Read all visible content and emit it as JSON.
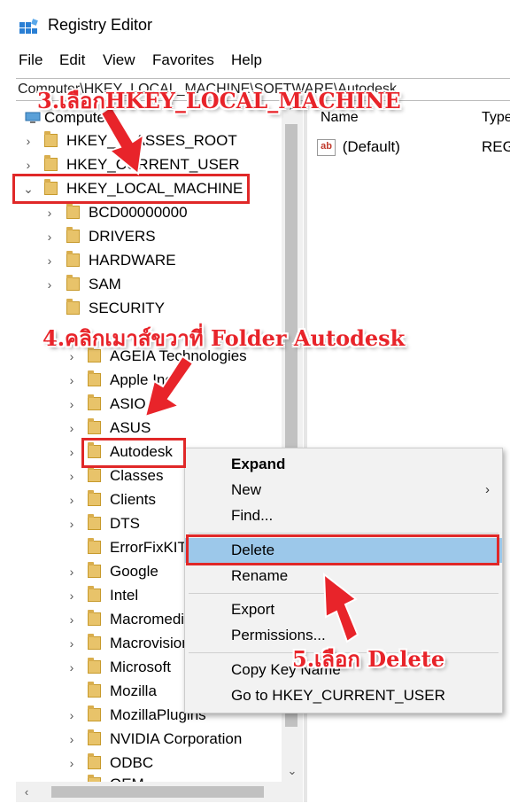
{
  "window": {
    "title": "Registry Editor"
  },
  "menu": [
    "File",
    "Edit",
    "View",
    "Favorites",
    "Help"
  ],
  "address": "Computer\\HKEY_LOCAL_MACHINE\\SOFTWARE\\Autodesk",
  "tree": {
    "root": "Computer",
    "hives": [
      "HKEY_CLASSES_ROOT",
      "HKEY_CURRENT_USER",
      "HKEY_LOCAL_MACHINE"
    ],
    "hklm_children": [
      "BCD00000000",
      "DRIVERS",
      "HARDWARE",
      "SAM",
      "SECURITY"
    ],
    "software_children": [
      "AGEIA Technologies",
      "Apple Inc.",
      "ASIO",
      "ASUS",
      "Autodesk",
      "Classes",
      "Clients",
      "DTS",
      "ErrorFixKIT",
      "Google",
      "Intel",
      "Macromedia",
      "Macrovision",
      "Microsoft",
      "Mozilla",
      "MozillaPlugins",
      "NVIDIA Corporation",
      "ODBC",
      "OEM"
    ]
  },
  "list": {
    "columns": [
      "Name",
      "Type"
    ],
    "rows": [
      {
        "name": "(Default)",
        "type": "REG"
      }
    ]
  },
  "context_menu": {
    "items": [
      "Expand",
      "New",
      "Find...",
      "Delete",
      "Rename",
      "Export",
      "Permissions...",
      "Copy Key Name",
      "Go to HKEY_CURRENT_USER"
    ],
    "highlighted": "Delete"
  },
  "annotations": {
    "step3": "3.เลือกHKEY_LOCAL_MACHINE",
    "step4": "4.คลิกเมาส์ขวาที่ Folder Autodesk",
    "step5": "5.เลือก Delete"
  },
  "colors": {
    "annotation": "#e8242a",
    "menu_highlight": "#9cc8ea",
    "folder": "#e8c36a"
  }
}
